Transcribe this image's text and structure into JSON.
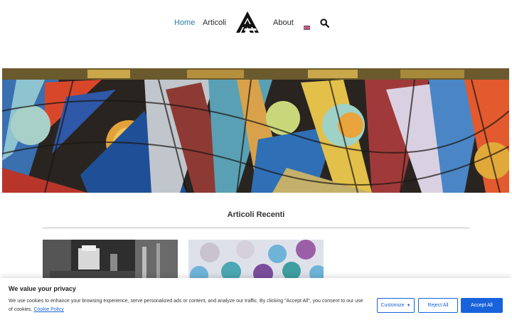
{
  "nav": {
    "home_label": "Home",
    "articles_label": "Articoli",
    "about_label": "About",
    "language": "English",
    "logo_icon": "site-logo-icon",
    "search_icon": "search-icon"
  },
  "hero": {
    "image": "stained-glass-window"
  },
  "section": {
    "title": "Articoli Recenti"
  },
  "cards": [
    {
      "image": "vintage-laboratory-photo"
    },
    {
      "image": "colored-test-tubes-photo"
    }
  ],
  "cookie": {
    "title": "We value your privacy",
    "text": "We use cookies to enhance your browsing experience, serve personalized ads or content, and analyze our traffic. By clicking \"Accept All\", you consent to our use of cookies.",
    "policy_link": "Cookie Policy",
    "customize_label": "Customize",
    "reject_label": "Reject All",
    "accept_label": "Accept All"
  },
  "colors": {
    "accent": "#2b7aa8",
    "cookie_button": "#1863dc"
  }
}
